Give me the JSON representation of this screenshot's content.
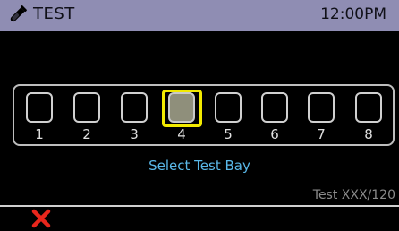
{
  "header": {
    "icon": "test-tube-icon",
    "title": "TEST",
    "time": "12:00PM",
    "bar_color": "#8f8db3"
  },
  "bays": [
    {
      "label": "1",
      "selected": false
    },
    {
      "label": "2",
      "selected": false
    },
    {
      "label": "3",
      "selected": false
    },
    {
      "label": "4",
      "selected": true
    },
    {
      "label": "5",
      "selected": false
    },
    {
      "label": "6",
      "selected": false
    },
    {
      "label": "7",
      "selected": false
    },
    {
      "label": "8",
      "selected": false
    }
  ],
  "prompt": "Select Test Bay",
  "test_counter": "Test XXX/120",
  "footer": {
    "cancel_icon": "close-icon",
    "cancel_color": "#e8261c"
  },
  "colors": {
    "highlight": "#f2ea00",
    "prompt": "#5ab8e8"
  }
}
